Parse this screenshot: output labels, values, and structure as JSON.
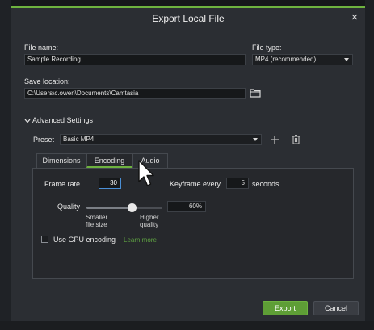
{
  "dialog": {
    "title": "Export Local File",
    "close_glyph": "×"
  },
  "file_name": {
    "label": "File name:",
    "value": "Sample Recording"
  },
  "file_type": {
    "label": "File type:",
    "value": "MP4 (recommended)"
  },
  "save_location": {
    "label": "Save location:",
    "value": "C:\\Users\\c.owen\\Documents\\Camtasia"
  },
  "advanced": {
    "label": "Advanced Settings",
    "expanded": true
  },
  "preset": {
    "label": "Preset",
    "value": "Basic MP4"
  },
  "tabs": [
    {
      "label": "Dimensions",
      "active": false
    },
    {
      "label": "Encoding",
      "active": true
    },
    {
      "label": "Audio",
      "active": false
    }
  ],
  "encoding": {
    "frame_rate_label": "Frame rate",
    "frame_rate_value": "30",
    "keyframe_label": "Keyframe every",
    "keyframe_value": "5",
    "keyframe_unit": "seconds",
    "quality_label": "Quality",
    "quality_value": "60%",
    "quality_fraction": 0.6,
    "smaller_label_1": "Smaller",
    "smaller_label_2": "file size",
    "higher_label_1": "Higher",
    "higher_label_2": "quality",
    "gpu_label": "Use GPU encoding",
    "gpu_checked": false,
    "learn_more": "Learn more"
  },
  "buttons": {
    "export": "Export",
    "cancel": "Cancel"
  },
  "colors": {
    "accent": "#6eb33f",
    "dialog_bg": "#2b2e33",
    "field_bg": "#16181a",
    "link": "#5fa342"
  },
  "icons": {
    "folder": "folder-icon",
    "add": "plus-icon",
    "delete": "trash-icon",
    "pointer": "mouse-pointer-icon"
  }
}
